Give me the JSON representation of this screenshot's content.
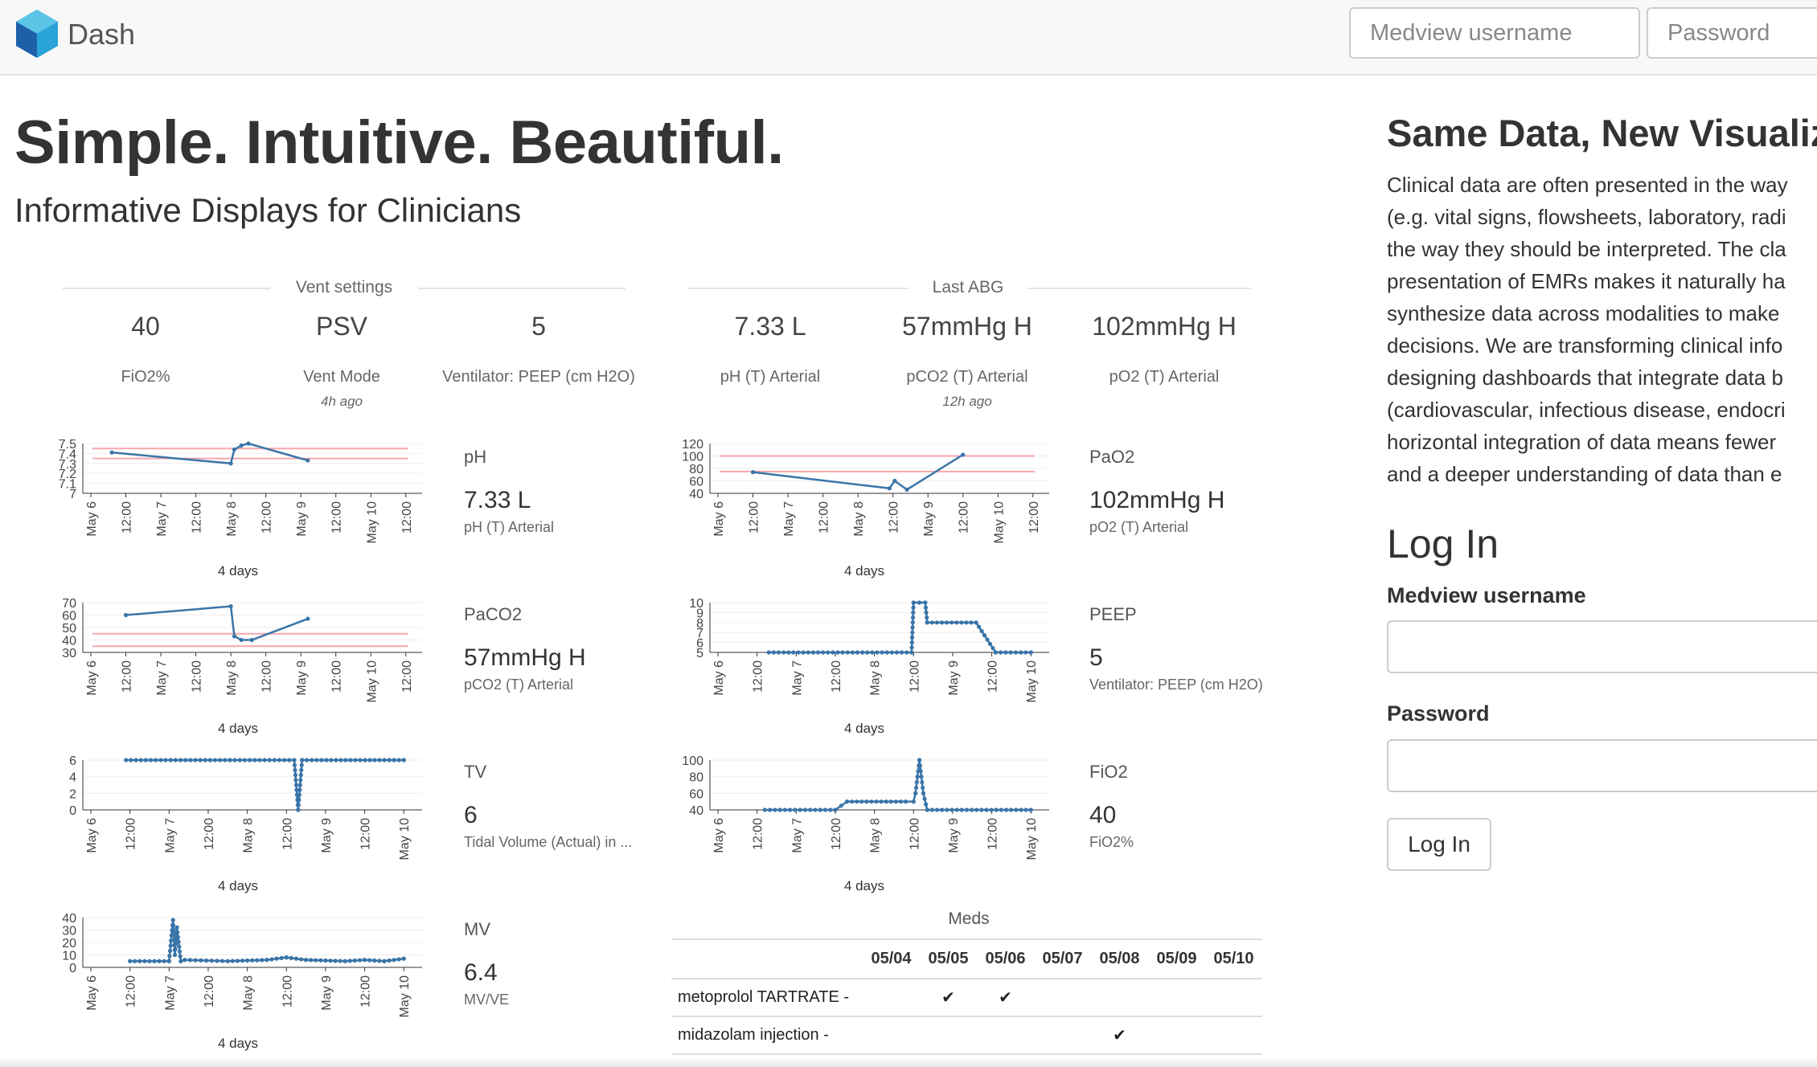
{
  "nav": {
    "brand": "Dash",
    "username_placeholder": "Medview username",
    "password_placeholder": "Password"
  },
  "hero": {
    "title": "Simple. Intuitive. Beautiful.",
    "subtitle": "Informative Displays for Clinicians"
  },
  "vent_settings": {
    "heading": "Vent settings",
    "stats": [
      {
        "value": "40",
        "label": "FiO2%",
        "ago": ""
      },
      {
        "value": "PSV",
        "label": "Vent Mode",
        "ago": "4h ago"
      },
      {
        "value": "5",
        "label": "Ventilator: PEEP (cm H2O)",
        "ago": ""
      }
    ]
  },
  "last_abg": {
    "heading": "Last ABG",
    "stats": [
      {
        "value": "7.33 L",
        "label": "pH (T) Arterial",
        "ago": ""
      },
      {
        "value": "57mmHg H",
        "label": "pCO2 (T) Arterial",
        "ago": "12h ago"
      },
      {
        "value": "102mmHg H",
        "label": "pO2 (T) Arterial",
        "ago": ""
      }
    ]
  },
  "chart_data": [
    {
      "type": "line",
      "name": "pH",
      "xlabels": [
        "May 6",
        "12:00",
        "May 7",
        "12:00",
        "May 8",
        "12:00",
        "May 9",
        "12:00",
        "May 10",
        "12:00"
      ],
      "yticks": [
        "7.5",
        "7.4",
        "7.3",
        "7.2",
        "7.1",
        "7"
      ],
      "ylim": [
        7.0,
        7.5
      ],
      "ref_lines": [
        7.45,
        7.35
      ],
      "x": [
        0.6,
        4.0,
        4.1,
        4.3,
        4.5,
        6.2
      ],
      "values": [
        7.41,
        7.3,
        7.44,
        7.48,
        7.5,
        7.33
      ],
      "span": "4 days",
      "side": {
        "title": "pH",
        "value": "7.33 L",
        "desc": "pH (T) Arterial"
      }
    },
    {
      "type": "line",
      "name": "PaO2",
      "xlabels": [
        "May 6",
        "12:00",
        "May 7",
        "12:00",
        "May 8",
        "12:00",
        "May 9",
        "12:00",
        "May 10",
        "12:00"
      ],
      "yticks": [
        "120",
        "100",
        "80",
        "60",
        "40"
      ],
      "ylim": [
        40,
        120
      ],
      "ref_lines": [
        100,
        75
      ],
      "x": [
        1.0,
        4.9,
        5.05,
        5.4,
        7.0
      ],
      "values": [
        74,
        48,
        60,
        46,
        102
      ],
      "span": "4 days",
      "side": {
        "title": "PaO2",
        "value": "102mmHg H",
        "desc": "pO2 (T) Arterial"
      }
    },
    {
      "type": "line",
      "name": "PaCO2",
      "xlabels": [
        "May 6",
        "12:00",
        "May 7",
        "12:00",
        "May 8",
        "12:00",
        "May 9",
        "12:00",
        "May 10",
        "12:00"
      ],
      "yticks": [
        "70",
        "60",
        "50",
        "40",
        "30"
      ],
      "ylim": [
        30,
        70
      ],
      "ref_lines": [
        45,
        35
      ],
      "x": [
        1.0,
        4.0,
        4.1,
        4.3,
        4.6,
        6.2
      ],
      "values": [
        60,
        67,
        43,
        40,
        40,
        57
      ],
      "span": "4 days",
      "side": {
        "title": "PaCO2",
        "value": "57mmHg H",
        "desc": "pCO2 (T) Arterial"
      }
    },
    {
      "type": "line",
      "name": "PEEP",
      "xlabels": [
        "May 6",
        "12:00",
        "May 7",
        "12:00",
        "May 8",
        "12:00",
        "May 9",
        "12:00",
        "May 10"
      ],
      "yticks": [
        "10",
        "9",
        "8",
        "7",
        "6",
        "5"
      ],
      "ylim": [
        5,
        10
      ],
      "ref_lines": [],
      "x": [
        1.3,
        4.95,
        5.0,
        5.3,
        5.35,
        6.6,
        7.1,
        8.0
      ],
      "values": [
        5,
        5,
        10,
        10,
        8,
        8,
        5,
        5
      ],
      "span": "4 days",
      "side": {
        "title": "PEEP",
        "value": "5",
        "desc": "Ventilator: PEEP (cm H2O)"
      }
    },
    {
      "type": "line",
      "name": "TV",
      "xlabels": [
        "May 6",
        "12:00",
        "May 7",
        "12:00",
        "May 8",
        "12:00",
        "May 9",
        "12:00",
        "May 10"
      ],
      "yticks": [
        "6",
        "4",
        "2",
        "0"
      ],
      "ylim": [
        0,
        6
      ],
      "ref_lines": [],
      "x": [
        0.9,
        5.2,
        5.3,
        5.4,
        8.0
      ],
      "values": [
        6,
        6,
        0,
        6,
        6
      ],
      "span": "4 days",
      "side": {
        "title": "TV",
        "value": "6",
        "desc": "Tidal Volume (Actual) in ..."
      }
    },
    {
      "type": "line",
      "name": "FiO2",
      "xlabels": [
        "May 6",
        "12:00",
        "May 7",
        "12:00",
        "May 8",
        "12:00",
        "May 9",
        "12:00",
        "May 10"
      ],
      "yticks": [
        "100",
        "80",
        "60",
        "40"
      ],
      "ylim": [
        40,
        100
      ],
      "ref_lines": [],
      "x": [
        1.2,
        3.0,
        3.3,
        4.8,
        5.0,
        5.05,
        5.15,
        5.25,
        5.35,
        8.0
      ],
      "values": [
        40,
        40,
        50,
        50,
        50,
        60,
        100,
        60,
        40,
        40
      ],
      "span": "4 days",
      "side": {
        "title": "FiO2",
        "value": "40",
        "desc": "FiO2%"
      }
    },
    {
      "type": "line",
      "name": "MV",
      "xlabels": [
        "May 6",
        "12:00",
        "May 7",
        "12:00",
        "May 8",
        "12:00",
        "May 9",
        "12:00",
        "May 10"
      ],
      "yticks": [
        "40",
        "30",
        "20",
        "10",
        "0"
      ],
      "ylim": [
        0,
        40
      ],
      "ref_lines": [],
      "x": [
        1.0,
        2.0,
        2.1,
        2.15,
        2.2,
        2.3,
        2.4,
        3.5,
        4.5,
        5.0,
        5.5,
        6.5,
        7.0,
        7.5,
        8.0
      ],
      "values": [
        5,
        5,
        38,
        10,
        32,
        5,
        6,
        5,
        6,
        8,
        6,
        5,
        6,
        5,
        7
      ],
      "span": "4 days",
      "side": {
        "title": "MV",
        "value": "6.4",
        "desc": "MV/VE"
      }
    }
  ],
  "meds": {
    "title": "Meds",
    "dates": [
      "05/04",
      "05/05",
      "05/06",
      "05/07",
      "05/08",
      "05/09",
      "05/10"
    ],
    "rows": [
      {
        "name": "metoprolol TARTRATE -",
        "given": [
          false,
          true,
          true,
          false,
          false,
          false,
          false
        ]
      },
      {
        "name": "midazolam injection -",
        "given": [
          false,
          false,
          false,
          false,
          true,
          false,
          false
        ]
      }
    ]
  },
  "right": {
    "title": "Same Data, New Visualiz",
    "paragraph_lines": [
      "Clinical data are often presented in the way",
      "(e.g. vital signs, flowsheets, laboratory, radi",
      "the way they should be interpreted. The cla",
      "presentation of EMRs makes it naturally ha",
      "synthesize data across modalities to make",
      "decisions. We are transforming clinical info",
      "designing dashboards that integrate data b",
      "(cardiovascular, infectious disease, endocri",
      "horizontal integration of data means fewer",
      "and a deeper understanding of data than e"
    ]
  },
  "login": {
    "title": "Log In",
    "username_label": "Medview username",
    "password_label": "Password",
    "button": "Log In"
  },
  "colors": {
    "series": "#3a75a8",
    "reference": "#f4a6ac",
    "grid": "#eeeeee",
    "navbar_bg": "#f8f8f8",
    "logo_dark": "#1d5fa8",
    "logo_light": "#35b3d6"
  },
  "icons": {
    "logo": "hexagon-cube-logo",
    "med_given": "checkmark-icon"
  }
}
